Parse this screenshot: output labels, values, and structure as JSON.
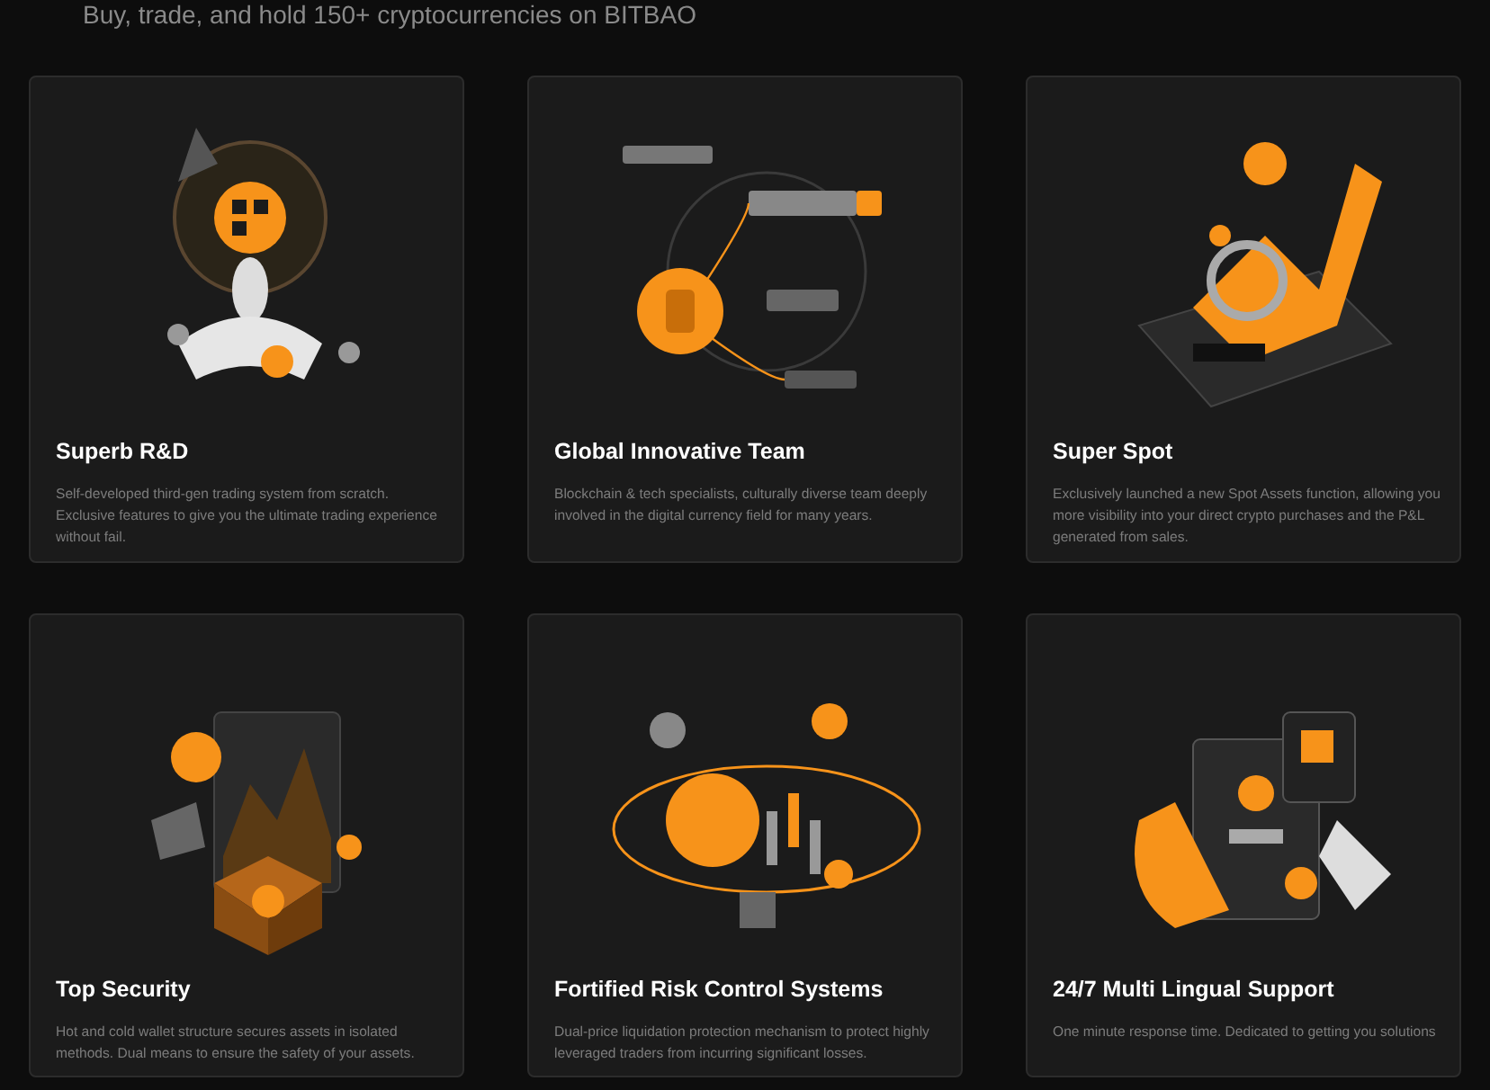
{
  "subtitle": "Buy, trade, and hold 150+ cryptocurrencies on BITBAO",
  "features": [
    {
      "kind": "rnd",
      "title": "Superb R&D",
      "description": "Self-developed third-gen trading system from scratch. Exclusive features to give you the ultimate trading experience without fail."
    },
    {
      "kind": "team",
      "title": "Global Innovative Team",
      "description": "Blockchain & tech specialists, culturally diverse team deeply involved in the digital currency field for many years."
    },
    {
      "kind": "spot",
      "title": "Super Spot",
      "description": "Exclusively launched a new Spot Assets function, allowing you more visibility into your direct crypto purchases and the P&L generated from sales."
    },
    {
      "kind": "security",
      "title": "Top Security",
      "description": "Hot and cold wallet structure secures assets in isolated methods. Dual means to ensure the safety of your assets."
    },
    {
      "kind": "risk",
      "title": "Fortified Risk Control Systems",
      "description": "Dual-price liquidation protection mechanism to protect highly leveraged traders from incurring significant losses."
    },
    {
      "kind": "support",
      "title": "24/7 Multi Lingual Support",
      "description": "One minute response time. Dedicated to getting you solutions"
    }
  ]
}
